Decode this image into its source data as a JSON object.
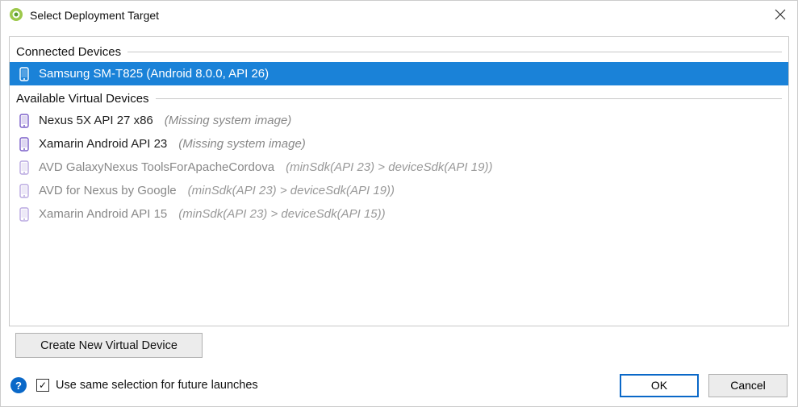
{
  "title": "Select Deployment Target",
  "sections": {
    "connected": {
      "label": "Connected Devices"
    },
    "virtual": {
      "label": "Available Virtual Devices"
    }
  },
  "connected_devices": [
    {
      "name": "Samsung SM-T825 (Android 8.0.0, API 26)",
      "note": "",
      "selected": true,
      "disabled": false
    }
  ],
  "virtual_devices": [
    {
      "name": "Nexus 5X API 27 x86",
      "note": "(Missing system image)",
      "selected": false,
      "disabled": false
    },
    {
      "name": "Xamarin Android API 23",
      "note": "(Missing system image)",
      "selected": false,
      "disabled": false
    },
    {
      "name": "AVD GalaxyNexus ToolsForApacheCordova",
      "note": "(minSdk(API 23) > deviceSdk(API 19))",
      "selected": false,
      "disabled": true
    },
    {
      "name": "AVD for Nexus by Google",
      "note": "(minSdk(API 23) > deviceSdk(API 19))",
      "selected": false,
      "disabled": true
    },
    {
      "name": "Xamarin Android API 15",
      "note": "(minSdk(API 23) > deviceSdk(API 15))",
      "selected": false,
      "disabled": true
    }
  ],
  "buttons": {
    "create": "Create New Virtual Device",
    "ok": "OK",
    "cancel": "Cancel"
  },
  "checkbox": {
    "label": "Use same selection for future launches",
    "checked": true
  },
  "colors": {
    "selection": "#1a82d8",
    "accent": "#0a68c8",
    "phone_icon": "#7a5fc9"
  }
}
